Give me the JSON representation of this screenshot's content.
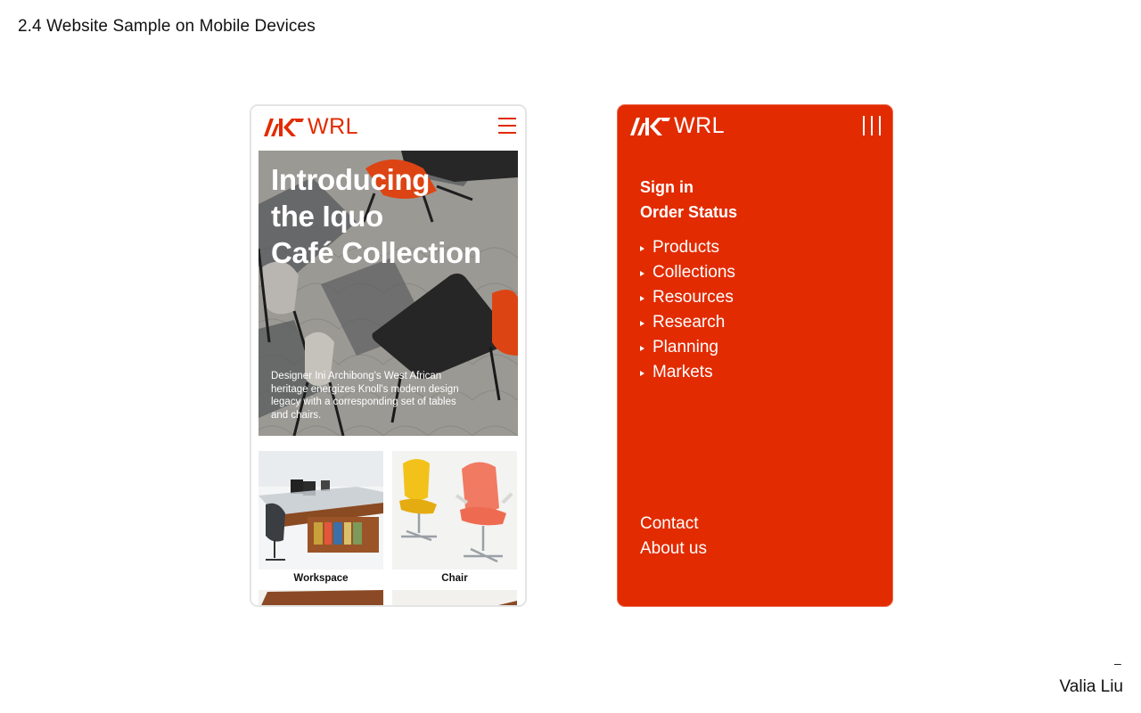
{
  "slide": {
    "title": "2.4 Website Sample on Mobile Devices",
    "dash": "–",
    "author": "Valia Liu"
  },
  "brand": {
    "name": "WRL",
    "accent": "#e22b00"
  },
  "phone_home": {
    "menu_icon": "hamburger-icon",
    "hero": {
      "title_lines": [
        "Introducing",
        "the Iquo",
        "Café Collection"
      ],
      "description": "Designer Ini Archibong's West African heritage energizes Knoll's modern design legacy with a corresponding set of tables and chairs."
    },
    "categories": [
      {
        "label": "Workspace"
      },
      {
        "label": "Chair"
      }
    ]
  },
  "phone_menu": {
    "close_icon": "close-bars-icon",
    "account_links": [
      "Sign in",
      "Order Status"
    ],
    "nav_items": [
      "Products",
      "Collections",
      "Resources",
      "Research",
      "Planning",
      "Markets"
    ],
    "footer_links": [
      "Contact",
      "About us"
    ]
  }
}
